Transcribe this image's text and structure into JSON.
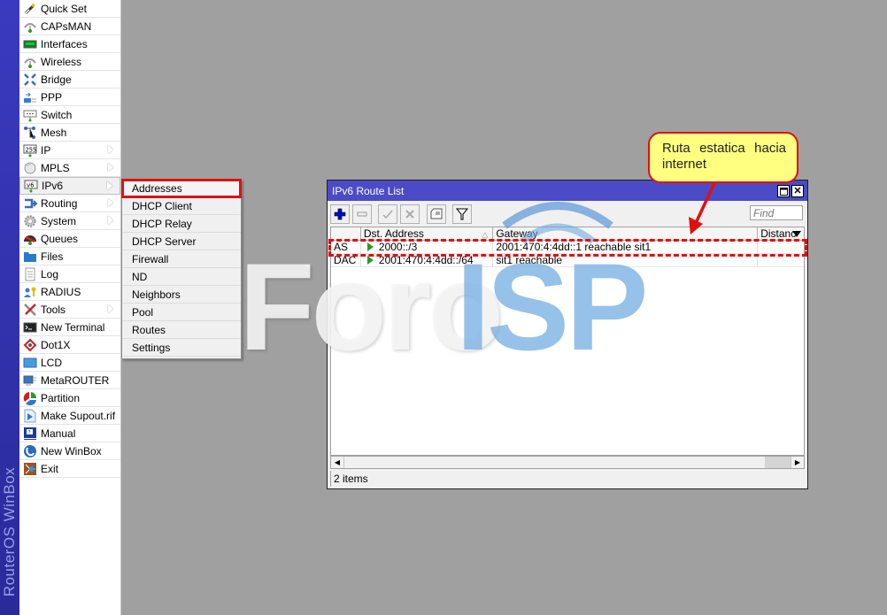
{
  "branding": {
    "vertical_text": "RouterOS WinBox"
  },
  "main_menu": {
    "items": [
      {
        "label": "Quick Set",
        "icon": "wand-icon",
        "submenu": false
      },
      {
        "label": "CAPsMAN",
        "icon": "antenna-icon",
        "submenu": false
      },
      {
        "label": "Interfaces",
        "icon": "interface-card-icon",
        "submenu": false
      },
      {
        "label": "Wireless",
        "icon": "wireless-icon",
        "submenu": false
      },
      {
        "label": "Bridge",
        "icon": "bridge-icon",
        "submenu": false
      },
      {
        "label": "PPP",
        "icon": "ppp-icon",
        "submenu": false
      },
      {
        "label": "Switch",
        "icon": "switch-icon",
        "submenu": false
      },
      {
        "label": "Mesh",
        "icon": "mesh-icon",
        "submenu": false
      },
      {
        "label": "IP",
        "icon": "ip-icon",
        "submenu": true
      },
      {
        "label": "MPLS",
        "icon": "mpls-icon",
        "submenu": true
      },
      {
        "label": "IPv6",
        "icon": "ipv6-icon",
        "submenu": true,
        "active": true
      },
      {
        "label": "Routing",
        "icon": "routing-icon",
        "submenu": true
      },
      {
        "label": "System",
        "icon": "gear-icon",
        "submenu": true
      },
      {
        "label": "Queues",
        "icon": "queues-icon",
        "submenu": false
      },
      {
        "label": "Files",
        "icon": "folder-icon",
        "submenu": false
      },
      {
        "label": "Log",
        "icon": "log-icon",
        "submenu": false
      },
      {
        "label": "RADIUS",
        "icon": "radius-icon",
        "submenu": false
      },
      {
        "label": "Tools",
        "icon": "tools-icon",
        "submenu": true
      },
      {
        "label": "New Terminal",
        "icon": "terminal-icon",
        "submenu": false
      },
      {
        "label": "Dot1X",
        "icon": "dot1x-icon",
        "submenu": false
      },
      {
        "label": "LCD",
        "icon": "lcd-icon",
        "submenu": false
      },
      {
        "label": "MetaROUTER",
        "icon": "metarouter-icon",
        "submenu": false
      },
      {
        "label": "Partition",
        "icon": "partition-icon",
        "submenu": false
      },
      {
        "label": "Make Supout.rif",
        "icon": "supout-icon",
        "submenu": false
      },
      {
        "label": "Manual",
        "icon": "manual-icon",
        "submenu": false
      },
      {
        "label": "New WinBox",
        "icon": "winbox-icon",
        "submenu": false
      },
      {
        "label": "Exit",
        "icon": "exit-icon",
        "submenu": false
      }
    ]
  },
  "ipv6_submenu": {
    "items": [
      "Addresses",
      "DHCP Client",
      "DHCP Relay",
      "DHCP Server",
      "Firewall",
      "ND",
      "Neighbors",
      "Pool",
      "Routes",
      "Settings"
    ],
    "selected": "Addresses"
  },
  "route_window": {
    "title": "IPv6 Route List",
    "find_placeholder": "Find",
    "columns": [
      "",
      "Dst. Address",
      "Gateway",
      "Distance"
    ],
    "columns_display": [
      "",
      "Dst. Address",
      "Gateway",
      "Distanc"
    ],
    "rows": [
      {
        "flags": "AS",
        "dst_address": "2000::/3",
        "gateway": "2001:470:4:4dd::1 reachable sit1",
        "distance": ""
      },
      {
        "flags": "DAC",
        "dst_address": "2001:470:4:4dd::/64",
        "gateway": "sit1 reachable",
        "distance": ""
      }
    ],
    "status": "2 items",
    "toolbar": [
      "add-icon",
      "remove-icon",
      "enable-icon",
      "disable-icon",
      "comment-icon",
      "filter-icon"
    ]
  },
  "annotation": {
    "callout_text": "Ruta estatica hacia internet"
  },
  "watermark": {
    "part1": "Foro",
    "part2": "ISP"
  },
  "colors": {
    "title_bar": "#4b4bc8",
    "brand_strip": "#3a3ac0",
    "annotation_red": "#e01010",
    "callout_fill": "#ffff80",
    "desktop": "#a0a0a0"
  }
}
